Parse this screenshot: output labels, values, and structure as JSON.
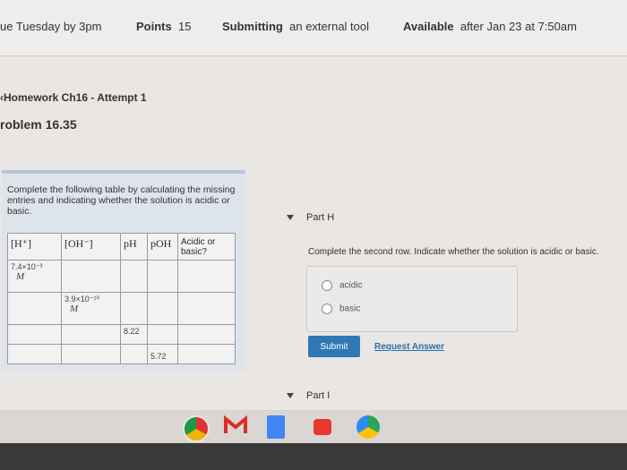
{
  "header": {
    "due": "ue Tuesday by 3pm",
    "points_label": "Points",
    "points_value": "15",
    "submitting_label": "Submitting",
    "submitting_value": "an external tool",
    "available_label": "Available",
    "available_value": "after Jan 23 at 7:50am"
  },
  "breadcrumb": "Homework Ch16 - Attempt 1",
  "problem_title": "roblem 16.35",
  "instructions": "Complete the following table by calculating the missing entries and indicating whether the solution is acidic or basic.",
  "table": {
    "headers": [
      "[H⁺]",
      "[OH⁻]",
      "pH",
      "pOH",
      "Acidic or basic?"
    ],
    "row1_h": "7.4×10⁻³",
    "row1_h_unit": "M",
    "row2_oh": "3.9×10⁻¹⁰",
    "row2_oh_unit": "M",
    "row3_ph": "8.22",
    "row4_poh": "5.72"
  },
  "part_h": {
    "title": "Part H",
    "question": "Complete the second row. Indicate whether the solution is acidic or basic.",
    "options": [
      "acidic",
      "basic"
    ],
    "submit": "Submit",
    "request": "Request Answer"
  },
  "part_i": {
    "title": "Part I"
  },
  "dock_apps": [
    "chrome-icon",
    "gmail-icon",
    "docs-icon",
    "youtube-icon",
    "play-store-icon"
  ],
  "colors": {
    "submit": "#2f78b5",
    "link": "#2b6ea8",
    "panel": "#dde4ec"
  }
}
